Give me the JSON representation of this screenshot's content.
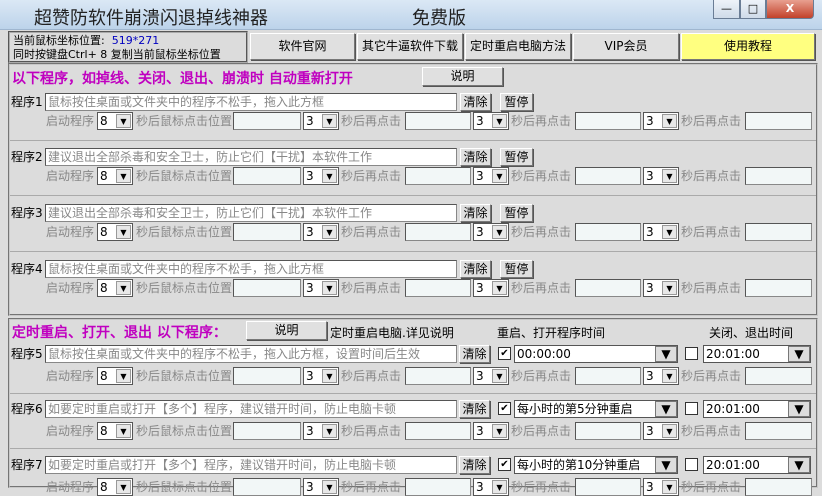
{
  "window": {
    "title": "超赞防软件崩溃闪退掉线神器",
    "edition": "免费版",
    "minimize": "—",
    "maximize": "□",
    "close": "X"
  },
  "info": {
    "coord_label": "当前鼠标坐标位置:",
    "coord_value": "519*271",
    "hint": "同时按键盘Ctrl+ 8 复制当前鼠标坐标位置"
  },
  "toolbar": [
    "软件官网",
    "其它牛逼软件下载",
    "定时重启电脑方法",
    "VIP会员",
    "使用教程"
  ],
  "section1": {
    "heading": "以下程序，如掉线、关闭、退出、崩溃时  自动重新打开",
    "explain": "说明"
  },
  "section2": {
    "heading": "定时重启、打开、退出 以下程序：",
    "explain": "说明",
    "note": "定时重启电脑.详见说明",
    "restart_col": "重启、打开程序时间",
    "close_col": "关闭、退出时间"
  },
  "labels": {
    "clear": "清除",
    "pause": "暂停",
    "start": "启动程序",
    "click_pos": "秒后鼠标点击位置",
    "click_again": "秒后再点击"
  },
  "programs": [
    {
      "label": "程序1",
      "placeholder": "鼠标按住桌面或文件夹中的程序不松手，拖入此方框",
      "delay": "8",
      "d2": "3",
      "d3": "3",
      "d4": "3"
    },
    {
      "label": "程序2",
      "placeholder": "建议退出全部杀毒和安全卫士，防止它们【干扰】本软件工作",
      "delay": "8",
      "d2": "3",
      "d3": "3",
      "d4": "3"
    },
    {
      "label": "程序3",
      "placeholder": "建议退出全部杀毒和安全卫士，防止它们【干扰】本软件工作",
      "delay": "8",
      "d2": "3",
      "d3": "3",
      "d4": "3"
    },
    {
      "label": "程序4",
      "placeholder": "鼠标按住桌面或文件夹中的程序不松手，拖入此方框",
      "delay": "8",
      "d2": "3",
      "d3": "3",
      "d4": "3"
    }
  ],
  "timed_programs": [
    {
      "label": "程序5",
      "placeholder": "鼠标按住桌面或文件夹中的程序不松手，拖入此方框，设置时间后生效",
      "restart_checked": true,
      "restart_time": "00:00:00",
      "close_checked": false,
      "close_time": "20:01:00",
      "delay": "8",
      "d2": "3",
      "d3": "3",
      "d4": "3"
    },
    {
      "label": "程序6",
      "placeholder": "如要定时重启或打开【多个】程序，建议错开时间，防止电脑卡顿",
      "restart_checked": true,
      "restart_time": "每小时的第5分钟重启",
      "close_checked": false,
      "close_time": "20:01:00",
      "delay": "8",
      "d2": "3",
      "d3": "3",
      "d4": "3"
    },
    {
      "label": "程序7",
      "placeholder": "如要定时重启或打开【多个】程序，建议错开时间，防止电脑卡顿",
      "restart_checked": true,
      "restart_time": "每小时的第10分钟重启",
      "close_checked": false,
      "close_time": "20:01:00",
      "delay": "8",
      "d2": "3",
      "d3": "3",
      "d4": "3"
    }
  ],
  "colors": {
    "heading": "#c000c0",
    "tutorial_button": "#ffff80",
    "coord_value": "#0000c0"
  }
}
